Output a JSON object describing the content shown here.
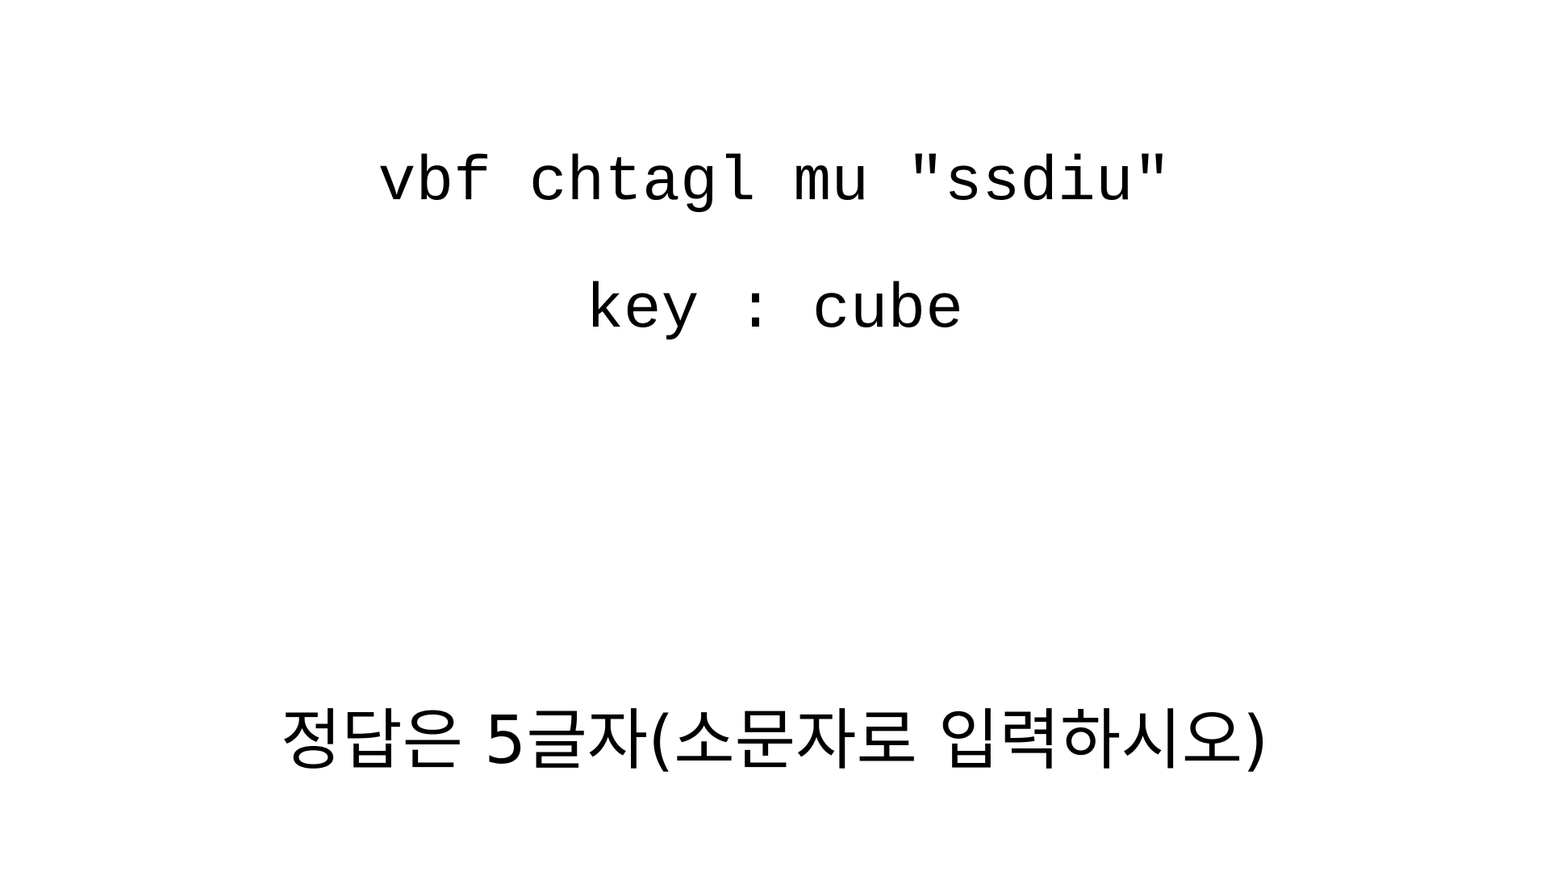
{
  "cipher_text": "vbf chtagl mu \"ssdiu\"",
  "key_text": "key : cube",
  "hint_text": "정답은 5글자(소문자로 입력하시오)",
  "colors": {
    "background": "#ffffff",
    "text": "#000000"
  }
}
